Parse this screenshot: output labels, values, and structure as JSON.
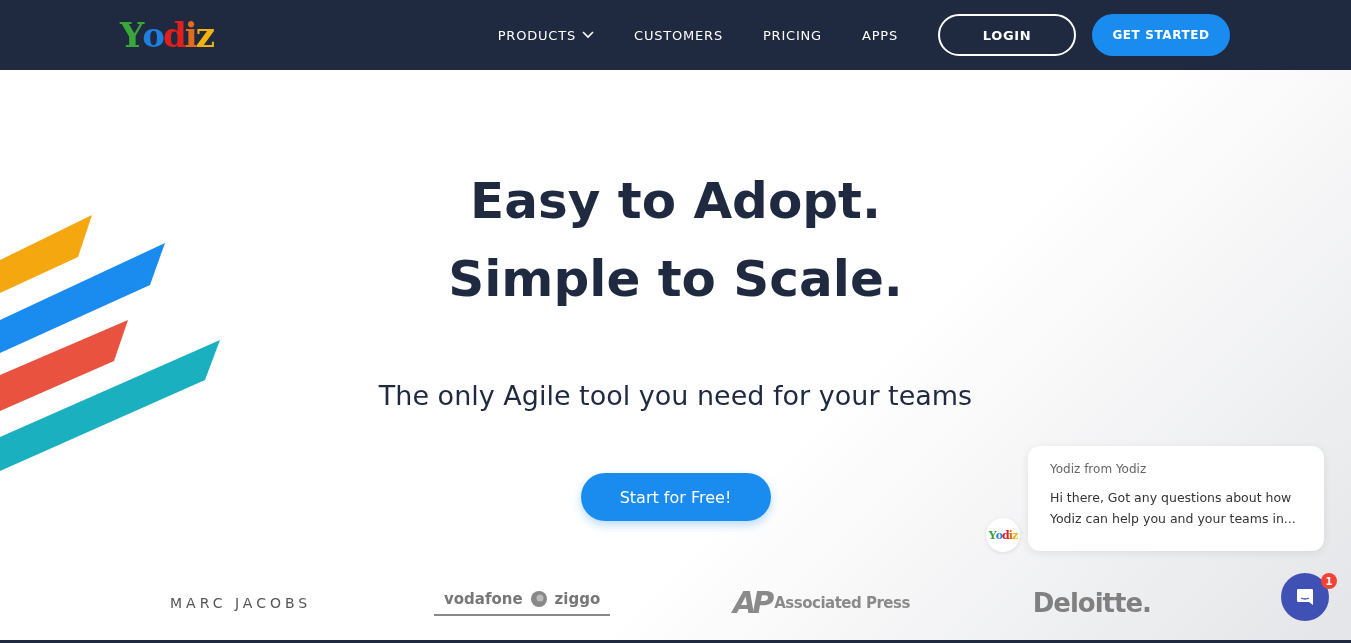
{
  "nav": {
    "logo": "Yodiz",
    "items": [
      {
        "label": "PRODUCTS",
        "dropdown": true
      },
      {
        "label": "CUSTOMERS",
        "dropdown": false
      },
      {
        "label": "PRICING",
        "dropdown": false
      },
      {
        "label": "APPS",
        "dropdown": false
      }
    ],
    "login": "LOGIN",
    "cta": "GET STARTED"
  },
  "hero": {
    "title_lines": [
      "Easy to Adopt.",
      "Simple to Scale."
    ],
    "subtitle": "The only Agile tool you need for your teams",
    "button": "Start for Free!"
  },
  "customers": [
    {
      "name": "MARC JACOBS",
      "kind": "spaced"
    },
    {
      "name": "vodafone",
      "kind": "vodafone",
      "extra": "ziggo"
    },
    {
      "name": "Associated Press",
      "kind": "ap",
      "extra": "AP"
    },
    {
      "name": "Deloitte.",
      "kind": "bold"
    }
  ],
  "chat": {
    "sender": "Yodiz from Yodiz",
    "message": "Hi there, Got any questions about how Yodiz can help you and your teams in...",
    "avatar": "Yodiz",
    "badge": "1"
  }
}
